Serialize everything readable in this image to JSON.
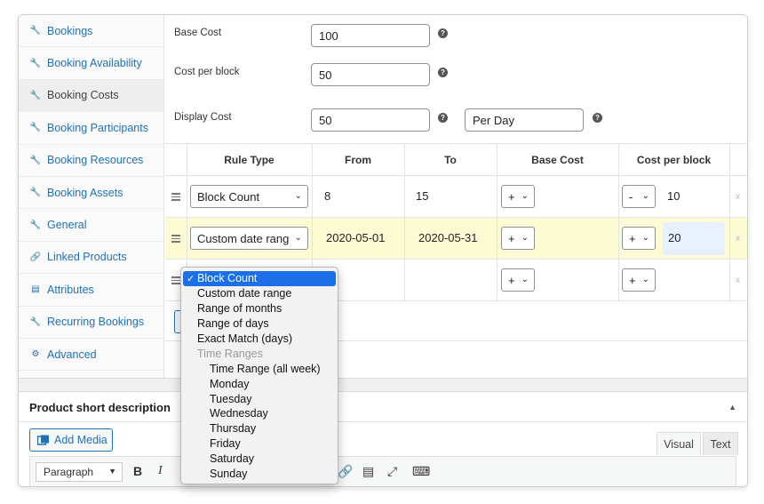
{
  "sidebar": {
    "items": [
      {
        "label": "Bookings",
        "icon": "wrench-icon"
      },
      {
        "label": "Booking Availability",
        "icon": "wrench-icon"
      },
      {
        "label": "Booking Costs",
        "icon": "wrench-icon",
        "active": true
      },
      {
        "label": "Booking Participants",
        "icon": "wrench-icon"
      },
      {
        "label": "Booking Resources",
        "icon": "wrench-icon"
      },
      {
        "label": "Booking Assets",
        "icon": "wrench-icon"
      },
      {
        "label": "General",
        "icon": "wrench-icon"
      },
      {
        "label": "Linked Products",
        "icon": "link-icon"
      },
      {
        "label": "Attributes",
        "icon": "list-icon"
      },
      {
        "label": "Recurring Bookings",
        "icon": "wrench-icon"
      },
      {
        "label": "Advanced",
        "icon": "gear-icon"
      }
    ]
  },
  "costs": {
    "base_cost_label": "Base Cost",
    "base_cost_value": "100",
    "cost_per_block_label": "Cost per block",
    "cost_per_block_value": "50",
    "display_cost_label": "Display Cost",
    "display_cost_value": "50",
    "display_cost_suffix": "Per Day",
    "help_glyph": "?"
  },
  "rules_table": {
    "headers": [
      "Rule Type",
      "From",
      "To",
      "Base Cost",
      "Cost per block"
    ],
    "rows": [
      {
        "rule_type": "Block Count",
        "from": "8",
        "to": "15",
        "base_op": "+",
        "base_cost": "",
        "block_op": "-",
        "block_cost": "10",
        "remove": "x"
      },
      {
        "rule_type": "Custom date rang",
        "from": "2020-05-01",
        "to": "2020-05-31",
        "base_op": "+",
        "base_cost": "",
        "block_op": "+",
        "block_cost": "20",
        "remove": "x"
      },
      {
        "rule_type": "Block Count",
        "from": "",
        "to": "",
        "base_op": "+",
        "base_cost": "",
        "block_op": "+",
        "block_cost": "",
        "remove": "x"
      }
    ]
  },
  "dropdown": {
    "selected": "Block Count",
    "options": [
      {
        "label": "Block Count",
        "selected": true
      },
      {
        "label": "Custom date range"
      },
      {
        "label": "Range of months"
      },
      {
        "label": "Range of days"
      },
      {
        "label": "Exact Match (days)"
      },
      {
        "label": "Time Ranges",
        "group": true
      },
      {
        "label": "Time Range (all week)",
        "indent": true
      },
      {
        "label": "Monday",
        "indent": true
      },
      {
        "label": "Tuesday",
        "indent": true
      },
      {
        "label": "Wednesday",
        "indent": true
      },
      {
        "label": "Thursday",
        "indent": true
      },
      {
        "label": "Friday",
        "indent": true
      },
      {
        "label": "Saturday",
        "indent": true
      },
      {
        "label": "Sunday",
        "indent": true
      }
    ]
  },
  "short_description": {
    "title": "Product short description",
    "add_media": "Add Media",
    "tab_visual": "Visual",
    "tab_text": "Text",
    "format_select": "Paragraph",
    "bold": "B",
    "italic": "I"
  },
  "colors": {
    "link": "#2271b1",
    "highlight_row": "#fdfbd3",
    "selected_option": "#1c6fe6"
  }
}
